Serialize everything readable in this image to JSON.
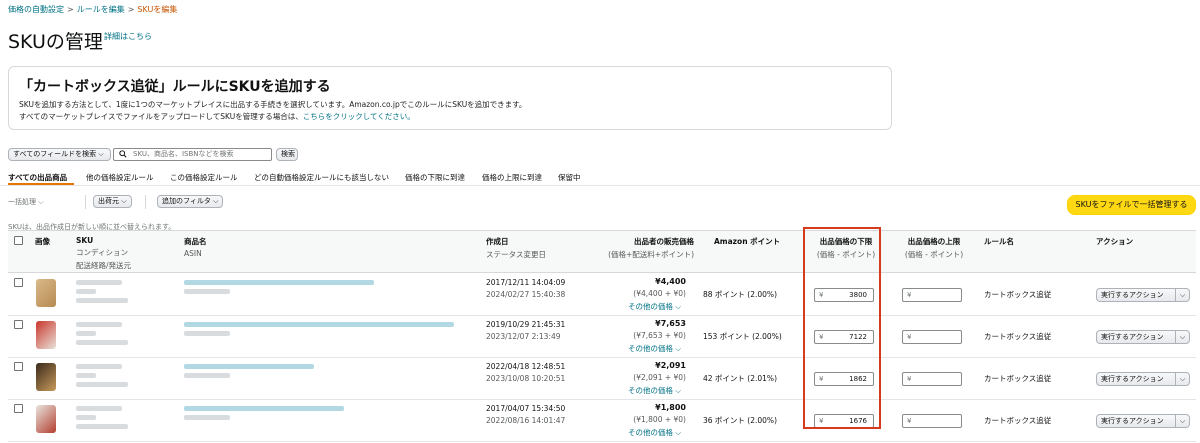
{
  "breadcrumb": {
    "item1": "価格の自動設定",
    "item2": "ルールを編集",
    "current": "SKUを編集",
    "sep": ">"
  },
  "header": {
    "title": "SKUの管理",
    "detail_link": "詳細はこちら"
  },
  "info_box": {
    "title": "「カートボックス追従」ルールにSKUを追加する",
    "line1": "SKUを追加する方法として、1度に1つのマーケットプレイスに出品する手続きを選択しています。Amazon.co.jpでこのルールにSKUを追加できます。",
    "line2_prefix": "すべてのマーケットプレイスでファイルをアップロードしてSKUを管理する場合は、",
    "line2_link": "こちらをクリックしてください。"
  },
  "search": {
    "field_select": "すべてのフィールドを検索",
    "placeholder": "SKU、商品名、ISBNなどを検索",
    "button": "検索"
  },
  "tabs": [
    "すべての出品商品",
    "他の価格設定ルール",
    "この価格設定ルール",
    "どの自動価格設定ルールにも該当しない",
    "価格の下限に到達",
    "価格の上限に到達",
    "保留中"
  ],
  "toolbar": {
    "bulk": "一括処理",
    "shipping": "出荷元",
    "add_filter": "追加のフィルタ",
    "upload": "SKUをファイルで一括管理する"
  },
  "sort_note": "SKUは、出品作成日が新しい順に並べ替えられます。",
  "columns": {
    "image": "画像",
    "sku": "SKU",
    "sku_sub1": "コンディション",
    "sku_sub2": "配送経路/発送元",
    "name": "商品名",
    "name_sub": "ASIN",
    "date": "作成日",
    "date_sub": "ステータス変更日",
    "price": "出品者の販売価格",
    "price_sub": "(価格+配送料+ポイント)",
    "points": "Amazon ポイント",
    "min": "出品価格の下限",
    "min_sub": "(価格 - ポイント)",
    "max": "出品価格の上限",
    "max_sub": "(価格 - ポイント)",
    "rule": "ルール名",
    "action": "アクション"
  },
  "rows": [
    {
      "created": "2017/12/11 14:04:09",
      "changed": "2024/02/27 15:40:38",
      "price": "¥4,400",
      "price_detail": "(¥4,400 + ¥0)",
      "other": "その他の価格",
      "points": "88 ポイント (2.00%)",
      "min_yen": "¥",
      "min": "3800",
      "max_yen": "¥",
      "rule": "カートボックス追従",
      "action": "実行するアクション"
    },
    {
      "created": "2019/10/29 21:45:31",
      "changed": "2023/12/07 2:13:49",
      "price": "¥7,653",
      "price_detail": "(¥7,653 + ¥0)",
      "other": "その他の価格",
      "points": "153 ポイント (2.00%)",
      "min_yen": "¥",
      "min": "7122",
      "max_yen": "¥",
      "rule": "カートボックス追従",
      "action": "実行するアクション"
    },
    {
      "created": "2022/04/18 12:48:51",
      "changed": "2023/10/08 10:20:51",
      "price": "¥2,091",
      "price_detail": "(¥2,091 + ¥0)",
      "other": "その他の価格",
      "points": "42 ポイント (2.01%)",
      "min_yen": "¥",
      "min": "1862",
      "max_yen": "¥",
      "rule": "カートボックス追従",
      "action": "実行するアクション"
    },
    {
      "created": "2017/04/07 15:34:50",
      "changed": "2022/08/16 14:01:47",
      "price": "¥1,800",
      "price_detail": "(¥1,800 + ¥0)",
      "other": "その他の価格",
      "points": "36 ポイント (2.00%)",
      "min_yen": "¥",
      "min": "1676",
      "max_yen": "¥",
      "rule": "カートボックス追従",
      "action": "実行するアクション"
    }
  ],
  "colors": {
    "link": "#007185",
    "accent": "#e77600",
    "highlight": "#d63a1f",
    "upload_btn": "#ffd814"
  }
}
